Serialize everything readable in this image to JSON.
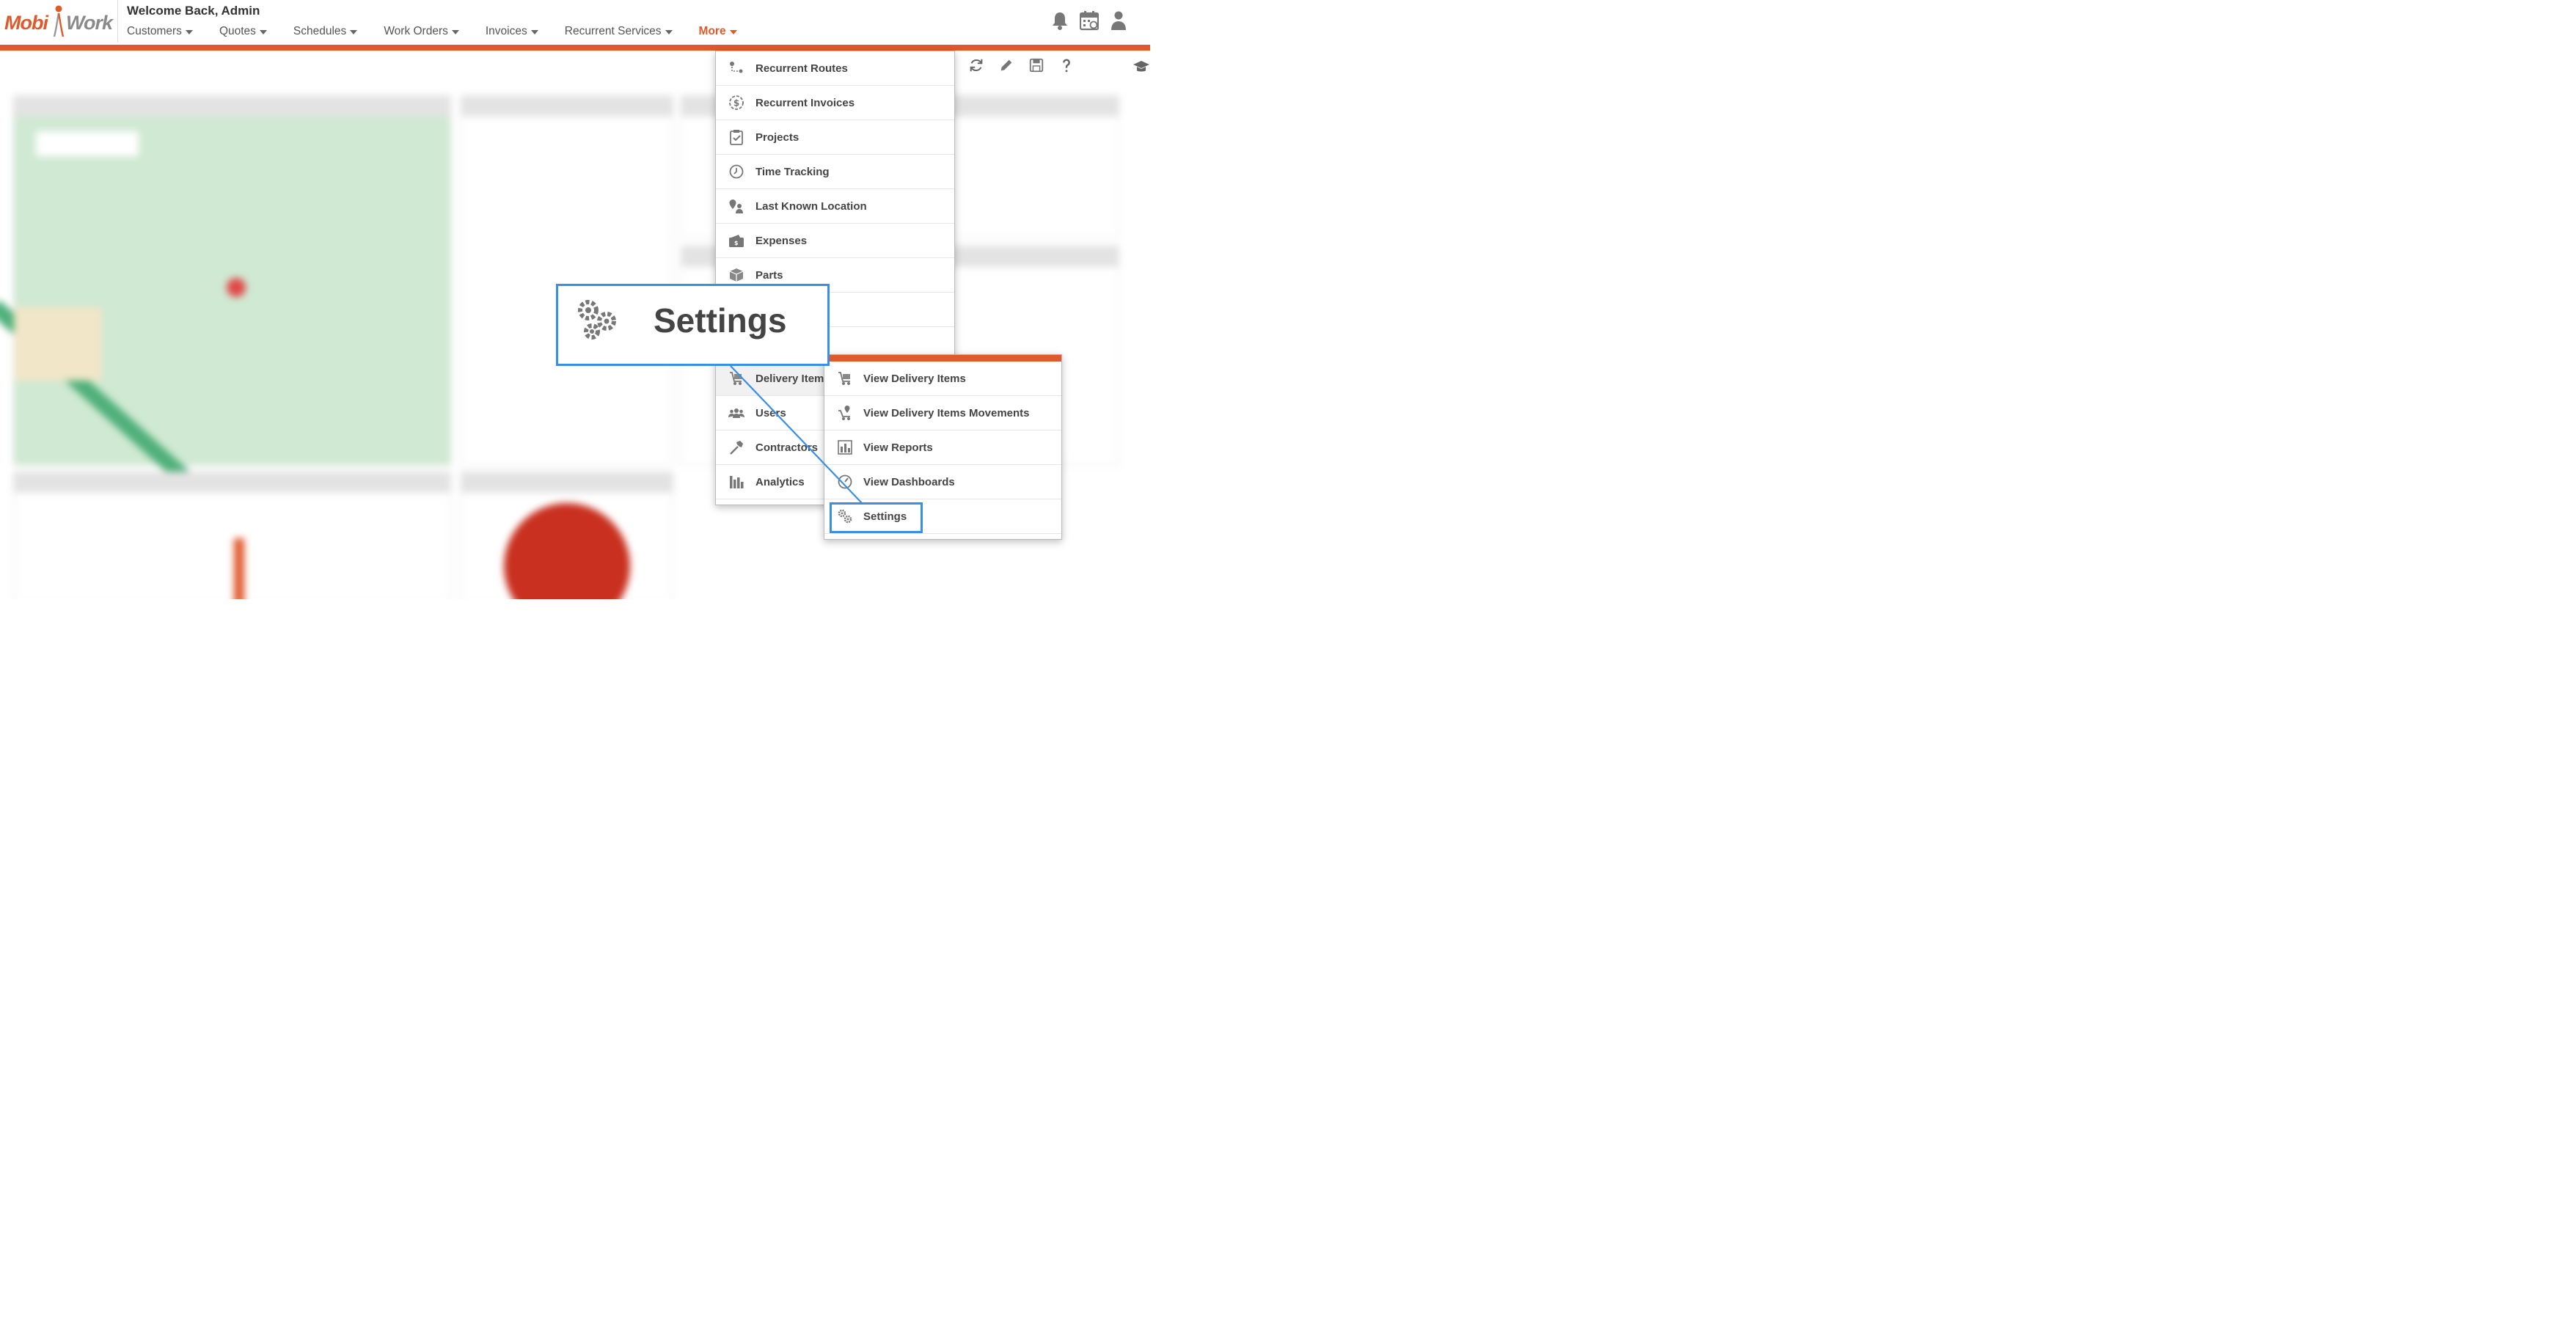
{
  "header": {
    "logo_left": "Mobi",
    "logo_right": "Work",
    "welcome": "Welcome Back,  Admin",
    "nav": [
      {
        "label": "Customers"
      },
      {
        "label": "Quotes"
      },
      {
        "label": "Schedules"
      },
      {
        "label": "Work Orders"
      },
      {
        "label": "Invoices"
      },
      {
        "label": "Recurrent Services"
      },
      {
        "label": "More"
      }
    ],
    "icons": [
      "bell-icon",
      "calendar-icon",
      "user-icon"
    ]
  },
  "toolbar_icons": [
    "refresh-icon",
    "pencil-icon",
    "save-icon",
    "help-icon",
    "graduation-cap-icon"
  ],
  "more_menu": {
    "items": [
      {
        "label": "Recurrent Routes",
        "icon": "route-icon"
      },
      {
        "label": "Recurrent Invoices",
        "icon": "dollar-circle-icon"
      },
      {
        "label": "Projects",
        "icon": "clipboard-check-icon"
      },
      {
        "label": "Time Tracking",
        "icon": "clock-icon"
      },
      {
        "label": "Last Known Location",
        "icon": "map-pin-person-icon"
      },
      {
        "label": "Expenses",
        "icon": "wallet-icon"
      },
      {
        "label": "Parts",
        "icon": "box-icon"
      },
      {
        "label": "",
        "icon": ""
      },
      {
        "label": "",
        "icon": ""
      },
      {
        "label": "Delivery Items",
        "icon": "cart-icon"
      },
      {
        "label": "Users",
        "icon": "users-icon"
      },
      {
        "label": "Contractors",
        "icon": "hammer-icon"
      },
      {
        "label": "Analytics",
        "icon": "bar-chart-icon"
      }
    ]
  },
  "delivery_submenu": {
    "items": [
      {
        "label": "View Delivery Items",
        "icon": "cart-icon"
      },
      {
        "label": "View Delivery Items Movements",
        "icon": "pin-cart-icon"
      },
      {
        "label": "View Reports",
        "icon": "report-icon"
      },
      {
        "label": "View Dashboards",
        "icon": "gauge-icon"
      },
      {
        "label": "Settings",
        "icon": "gears-icon"
      }
    ]
  },
  "callout": {
    "label": "Settings",
    "icon": "gears-icon"
  },
  "colors": {
    "brand_orange": "#e0592b",
    "highlight_blue": "#3a8ee6"
  }
}
